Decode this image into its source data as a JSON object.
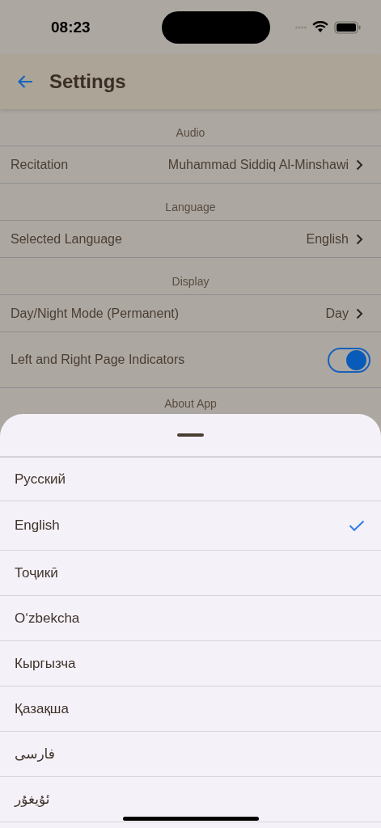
{
  "status_bar": {
    "time": "08:23"
  },
  "app_bar": {
    "title": "Settings"
  },
  "sections": [
    {
      "header": "Audio",
      "rows": [
        {
          "kind": "link",
          "label": "Recitation",
          "value": "Muhammad Siddiq Al-Minshawi"
        }
      ]
    },
    {
      "header": "Language",
      "rows": [
        {
          "kind": "link",
          "label": "Selected Language",
          "value": "English"
        }
      ]
    },
    {
      "header": "Display",
      "rows": [
        {
          "kind": "link",
          "label": "Day/Night Mode (Permanent)",
          "value": "Day"
        },
        {
          "kind": "toggle",
          "label": "Left and Right Page Indicators",
          "on": true
        }
      ]
    },
    {
      "header": "About App"
    }
  ],
  "sheet": {
    "languages": [
      {
        "label": "Русский",
        "selected": false
      },
      {
        "label": "English",
        "selected": true
      },
      {
        "label": "Тоҷикӣ",
        "selected": false
      },
      {
        "label": "O‘zbekcha",
        "selected": false
      },
      {
        "label": "Кыргызча",
        "selected": false
      },
      {
        "label": "Қазақша",
        "selected": false
      },
      {
        "label": "فارسی",
        "selected": false
      },
      {
        "label": "ئۇيغۇر",
        "selected": false
      }
    ]
  }
}
